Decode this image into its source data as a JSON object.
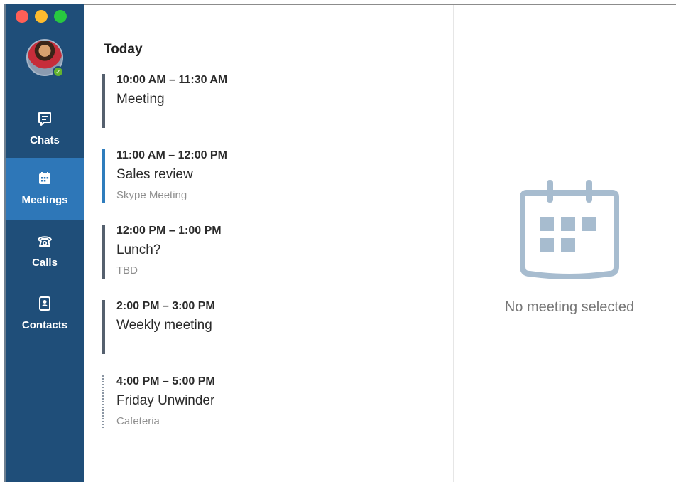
{
  "sidebar": {
    "window_controls": [
      "close",
      "minimize",
      "zoom"
    ],
    "presence_icon": "checkmark-icon",
    "presence_color": "#64b42e",
    "items": [
      {
        "label": "Chats",
        "icon": "chat-icon",
        "active": false
      },
      {
        "label": "Meetings",
        "icon": "calendar-icon",
        "active": true
      },
      {
        "label": "Calls",
        "icon": "phone-icon",
        "active": false
      },
      {
        "label": "Contacts",
        "icon": "contact-card-icon",
        "active": false
      }
    ],
    "colors": {
      "background": "#1f4e79",
      "active": "#2e77b8"
    }
  },
  "agenda": {
    "heading": "Today",
    "meetings": [
      {
        "time": "10:00 AM – 11:30 AM",
        "title": "Meeting",
        "subtitle": ""
      },
      {
        "time": "11:00 AM – 12:00 PM",
        "title": "Sales review",
        "subtitle": "Skype Meeting"
      },
      {
        "time": "12:00 PM – 1:00 PM",
        "title": "Lunch?",
        "subtitle": "TBD"
      },
      {
        "time": "2:00 PM – 3:00 PM",
        "title": "Weekly meeting",
        "subtitle": ""
      },
      {
        "time": "4:00 PM – 5:00 PM",
        "title": "Friday Unwinder",
        "subtitle": "Cafeteria"
      }
    ]
  },
  "detail": {
    "empty_icon": "calendar-icon",
    "empty_text": "No meeting selected",
    "icon_color": "#a7bccf"
  }
}
